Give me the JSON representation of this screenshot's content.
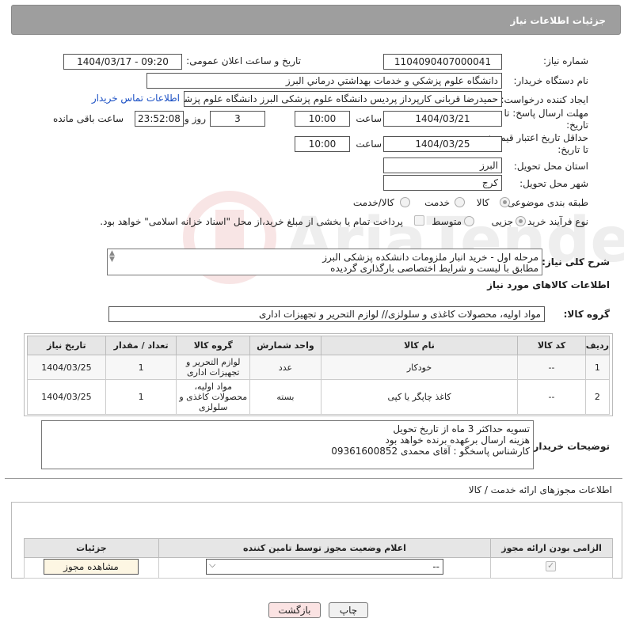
{
  "header": {
    "title": "جزئیات اطلاعات نیاز"
  },
  "form": {
    "need_number_label": "شماره نیاز:",
    "need_number": "1104090407000041",
    "announce_label": "تاریخ و ساعت اعلان عمومی:",
    "announce_value": "1404/03/17 - 09:20",
    "buyer_org_label": "نام دستگاه خریدار:",
    "buyer_org": "دانشگاه علوم پزشکي و خدمات بهداشتي  درماني البرز",
    "requester_label": "ایجاد کننده درخواست:",
    "requester": "حمیدرضا قربانی کارپرداز پردیس دانشگاه علوم پزشکی البرز دانشگاه علوم پزشک",
    "contact_link": "اطلاعات تماس خریدار",
    "deadline_label_1": "مهلت ارسال پاسخ: تا",
    "deadline_label_2": "تاریخ:",
    "deadline_date": "1404/03/21",
    "time_label": "ساعت",
    "deadline_time": "10:00",
    "days_value": "3",
    "days_label": "روز و",
    "remaining_time": "23:52:08",
    "remaining_label": "ساعت باقی مانده",
    "validity_label_1": "حداقل تاریخ اعتبار قیمت:",
    "validity_label_2": "تا تاریخ:",
    "validity_date": "1404/03/25",
    "validity_time": "10:00",
    "province_label": "استان محل تحویل:",
    "province": "البرز",
    "city_label": "شهر محل تحویل:",
    "city": "کرج",
    "category_label": "طبقه بندی موضوعی:",
    "category_options": [
      "کالا",
      "خدمت",
      "کالا/خدمت"
    ],
    "process_label": "نوع فرآیند خرید :",
    "process_options": [
      "جزیی",
      "متوسط"
    ],
    "process_note": "پرداخت تمام یا بخشی از مبلغ خرید،از محل \"اسناد خزانه اسلامی\" خواهد بود."
  },
  "description": {
    "label": "شرح کلی نیاز:",
    "text": "مرحله اول - خرید انبار ملزومات دانشکده پزشکی البرز\nمطابق با لیست و شرایط اختصاصی بارگذاری گردیده"
  },
  "goods": {
    "section_title": "اطلاعات کالاهای مورد نیاز",
    "group_label": "گروه کالا:",
    "group_value": "مواد اولیه، محصولات کاغذی و سلولزی// لوازم التحریر و تجهیزات اداری",
    "headers": [
      "ردیف",
      "کد کالا",
      "نام کالا",
      "واحد شمارش",
      "گروه کالا",
      "تعداد / مقدار",
      "تاریخ نیاز"
    ],
    "rows": [
      {
        "index": "1",
        "code": "--",
        "name": "خودکار",
        "unit": "عدد",
        "group": "لوازم التحریر و تجهیزات اداری",
        "qty": "1",
        "date": "1404/03/25"
      },
      {
        "index": "2",
        "code": "--",
        "name": "کاغذ چاپگر یا کپی",
        "unit": "بسته",
        "group": "مواد اولیه، محصولات کاغذی و سلولزی",
        "qty": "1",
        "date": "1404/03/25"
      }
    ]
  },
  "buyer_notes": {
    "label": "توضیحات خریدار:",
    "text": "تسویه حداکثر 3 ماه از تاریخ تحویل\nهزینه ارسال برعهده برنده خواهد بود\nکارشناس پاسخگو : آقای محمدی 09361600852"
  },
  "permits": {
    "section_title": "اطلاعات مجوزهای ارائه خدمت / کالا",
    "headers": [
      "الزامی بودن ارائه مجوز",
      "اعلام وضعیت مجوز توسط تامین کننده",
      "جزئیات"
    ],
    "select_value": "--",
    "view_button": "مشاهده مجوز"
  },
  "footer": {
    "print_button": "چاپ",
    "back_button": "بازگشت"
  },
  "colors": {
    "header_bg": "#9e9e9e",
    "link": "#1a4fc4",
    "back_button_bg": "#fbe3e3"
  }
}
